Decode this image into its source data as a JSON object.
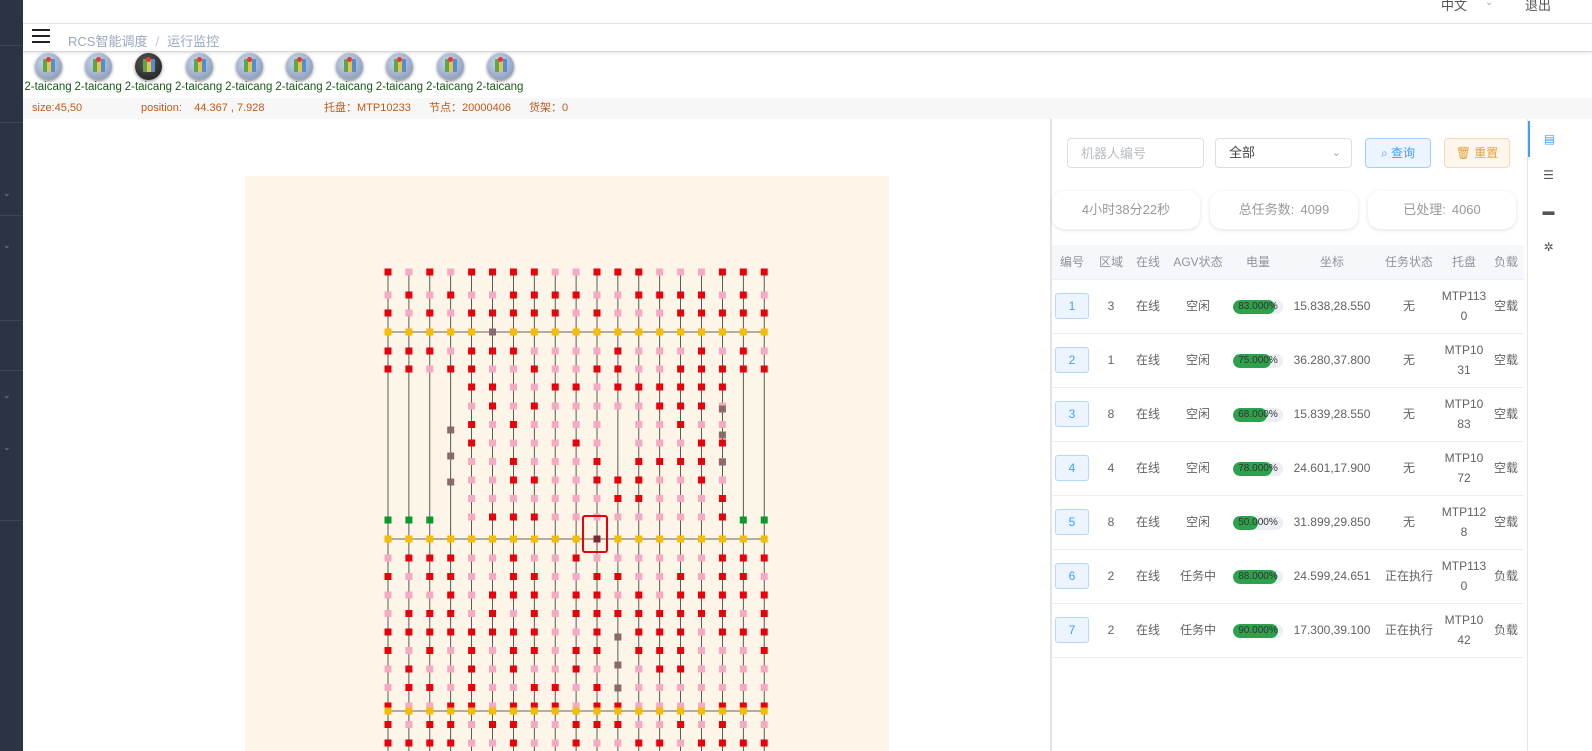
{
  "header": {
    "language": "中文",
    "logout": "退出"
  },
  "breadcrumb": {
    "home": "RCS智能调度",
    "sep": "/",
    "current": "运行监控"
  },
  "maps": [
    {
      "label": "2-taicang",
      "active": false
    },
    {
      "label": "2-taicang",
      "active": false
    },
    {
      "label": "2-taicang",
      "active": true
    },
    {
      "label": "2-taicang",
      "active": false
    },
    {
      "label": "2-taicang",
      "active": false
    },
    {
      "label": "2-taicang",
      "active": false
    },
    {
      "label": "2-taicang",
      "active": false
    },
    {
      "label": "2-taicang",
      "active": false
    },
    {
      "label": "2-taicang",
      "active": false
    },
    {
      "label": "2-taicang",
      "active": false
    }
  ],
  "info": {
    "size": "size:45,50",
    "position": "position:    44.367 , 7.928",
    "pallet": "托盘：MTP10233",
    "node": "节点：20000406",
    "shelf": "货架：0"
  },
  "filters": {
    "robot_placeholder": "机器人编号",
    "status_value": "全部",
    "query_label": "查询",
    "reset_label": "重置"
  },
  "stats": {
    "uptime": "4小时38分22秒",
    "total_label": "总任务数:",
    "total_value": "4099",
    "done_label": "已处理:",
    "done_value": "4060"
  },
  "table": {
    "headers": [
      "编号",
      "区域",
      "在线",
      "AGV状态",
      "电量",
      "坐标",
      "任务状态",
      "托盘",
      "负载"
    ],
    "rows": [
      {
        "id": "1",
        "zone": "3",
        "online": "在线",
        "agv": "空闲",
        "battery": 83,
        "battery_text": "83.000%",
        "coord": "15.838,28.550",
        "task": "无",
        "pallet": "MTP113 0",
        "load": "空载"
      },
      {
        "id": "2",
        "zone": "1",
        "online": "在线",
        "agv": "空闲",
        "battery": 75,
        "battery_text": "75.000%",
        "coord": "36.280,37.800",
        "task": "无",
        "pallet": "MTP10 31",
        "load": "空载"
      },
      {
        "id": "3",
        "zone": "8",
        "online": "在线",
        "agv": "空闲",
        "battery": 68,
        "battery_text": "68.000%",
        "coord": "15.839,28.550",
        "task": "无",
        "pallet": "MTP10 83",
        "load": "空载"
      },
      {
        "id": "4",
        "zone": "4",
        "online": "在线",
        "agv": "空闲",
        "battery": 78,
        "battery_text": "78.000%",
        "coord": "24.601,17.900",
        "task": "无",
        "pallet": "MTP10 72",
        "load": "空载"
      },
      {
        "id": "5",
        "zone": "8",
        "online": "在线",
        "agv": "空闲",
        "battery": 50,
        "battery_text": "50.000%",
        "coord": "31.899,29.850",
        "task": "无",
        "pallet": "MTP112 8",
        "load": "空载"
      },
      {
        "id": "6",
        "zone": "2",
        "online": "在线",
        "agv": "任务中",
        "battery": 88,
        "battery_text": "88.000%",
        "coord": "24.599,24.651",
        "task": "正在执行",
        "pallet": "MTP113 0",
        "load": "负载"
      },
      {
        "id": "7",
        "zone": "2",
        "online": "在线",
        "agv": "任务中",
        "battery": 90,
        "battery_text": "90.000%",
        "coord": "17.300,39.100",
        "task": "正在执行",
        "pallet": "MTP10 42",
        "load": "负载"
      }
    ]
  },
  "colors": {
    "rack_red": "#e8000b",
    "rack_pink": "#f6a9c3",
    "node_yellow": "#f5bd00",
    "charger_green": "#0a9a2a",
    "special_brown": "#8a6a6a",
    "battery_green": "#2da14c"
  },
  "icons": {
    "side_tabs": [
      "document-icon",
      "sliders-icon",
      "robot-icon",
      "settings-icon"
    ]
  }
}
